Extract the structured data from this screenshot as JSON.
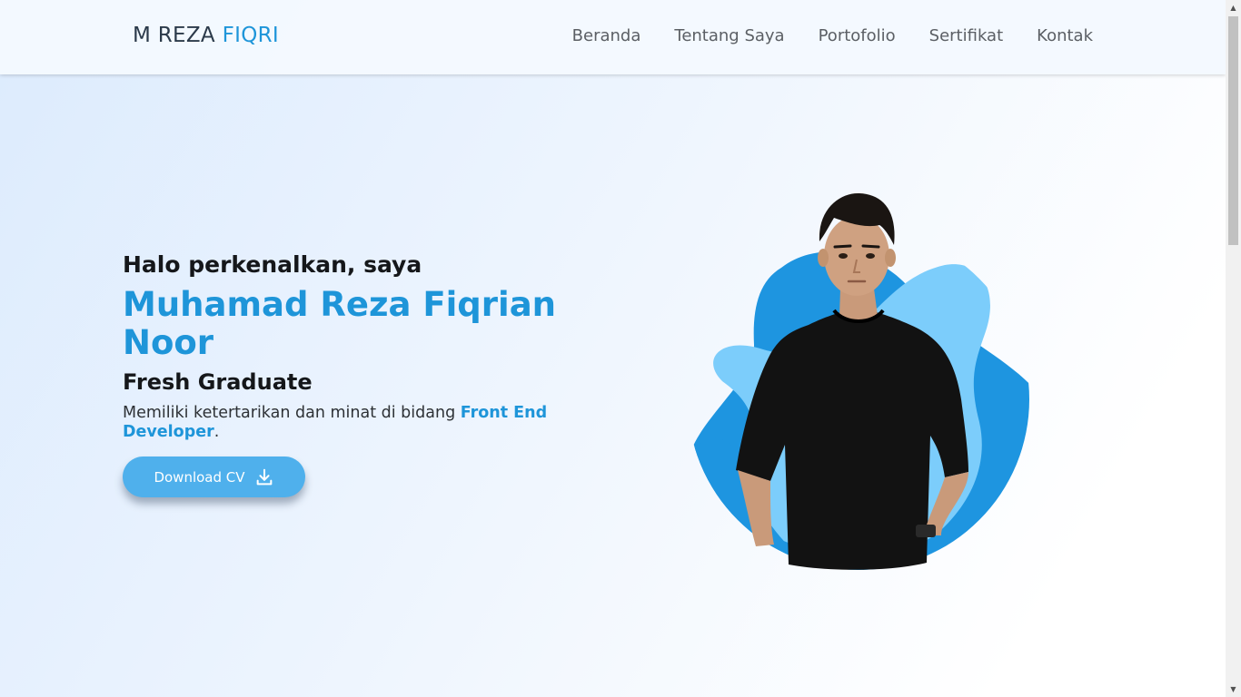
{
  "header": {
    "brand_prefix": "M REZA",
    "brand_accent": "FIQRI",
    "nav": [
      {
        "label": "Beranda"
      },
      {
        "label": "Tentang Saya"
      },
      {
        "label": "Portofolio"
      },
      {
        "label": "Sertifikat"
      },
      {
        "label": "Kontak"
      }
    ]
  },
  "hero": {
    "greeting": "Halo perkenalkan, saya",
    "name": "Muhamad Reza Fiqrian Noor",
    "role": "Fresh Graduate",
    "description_prefix": "Memiliki ketertarikan dan minat di bidang ",
    "description_highlight": "Front End Developer",
    "description_suffix": ".",
    "cv_button_label": "Download CV",
    "cv_button_icon": "download-icon"
  },
  "colors": {
    "accent": "#1e95d9",
    "button": "#4fb0ec",
    "blob_dark": "#1e95e0",
    "blob_light": "#7ccdfb",
    "text": "#15171a"
  }
}
